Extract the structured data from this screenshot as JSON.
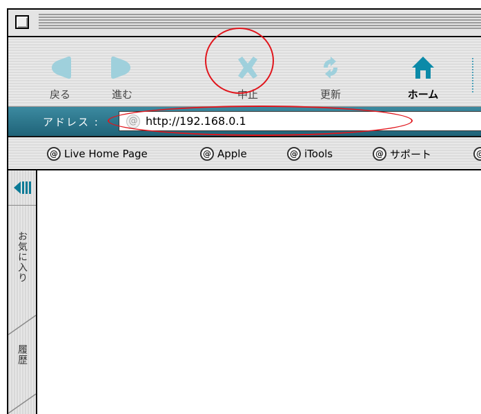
{
  "toolbar": {
    "buttons": [
      {
        "label": "戻る",
        "icon": "back-arrow-icon"
      },
      {
        "label": "進む",
        "icon": "forward-arrow-icon"
      },
      {
        "label": "中止",
        "icon": "stop-x-icon"
      },
      {
        "label": "更新",
        "icon": "refresh-icon"
      },
      {
        "label": "ホーム",
        "icon": "home-icon"
      }
    ]
  },
  "address": {
    "label": "アドレス",
    "value": "http://192.168.0.1"
  },
  "favorites": {
    "items": [
      {
        "label": "Live Home Page"
      },
      {
        "label": "Apple"
      },
      {
        "label": "iTools"
      },
      {
        "label": "サポート"
      }
    ]
  },
  "sidebar": {
    "tabs": [
      {
        "label": "お気に入り"
      },
      {
        "label": "履歴"
      }
    ]
  },
  "colors": {
    "accent": "#2a7a90",
    "annotation": "#e0151c",
    "icon_dim": "#9fd0dc",
    "icon_home": "#0b8aa8"
  }
}
